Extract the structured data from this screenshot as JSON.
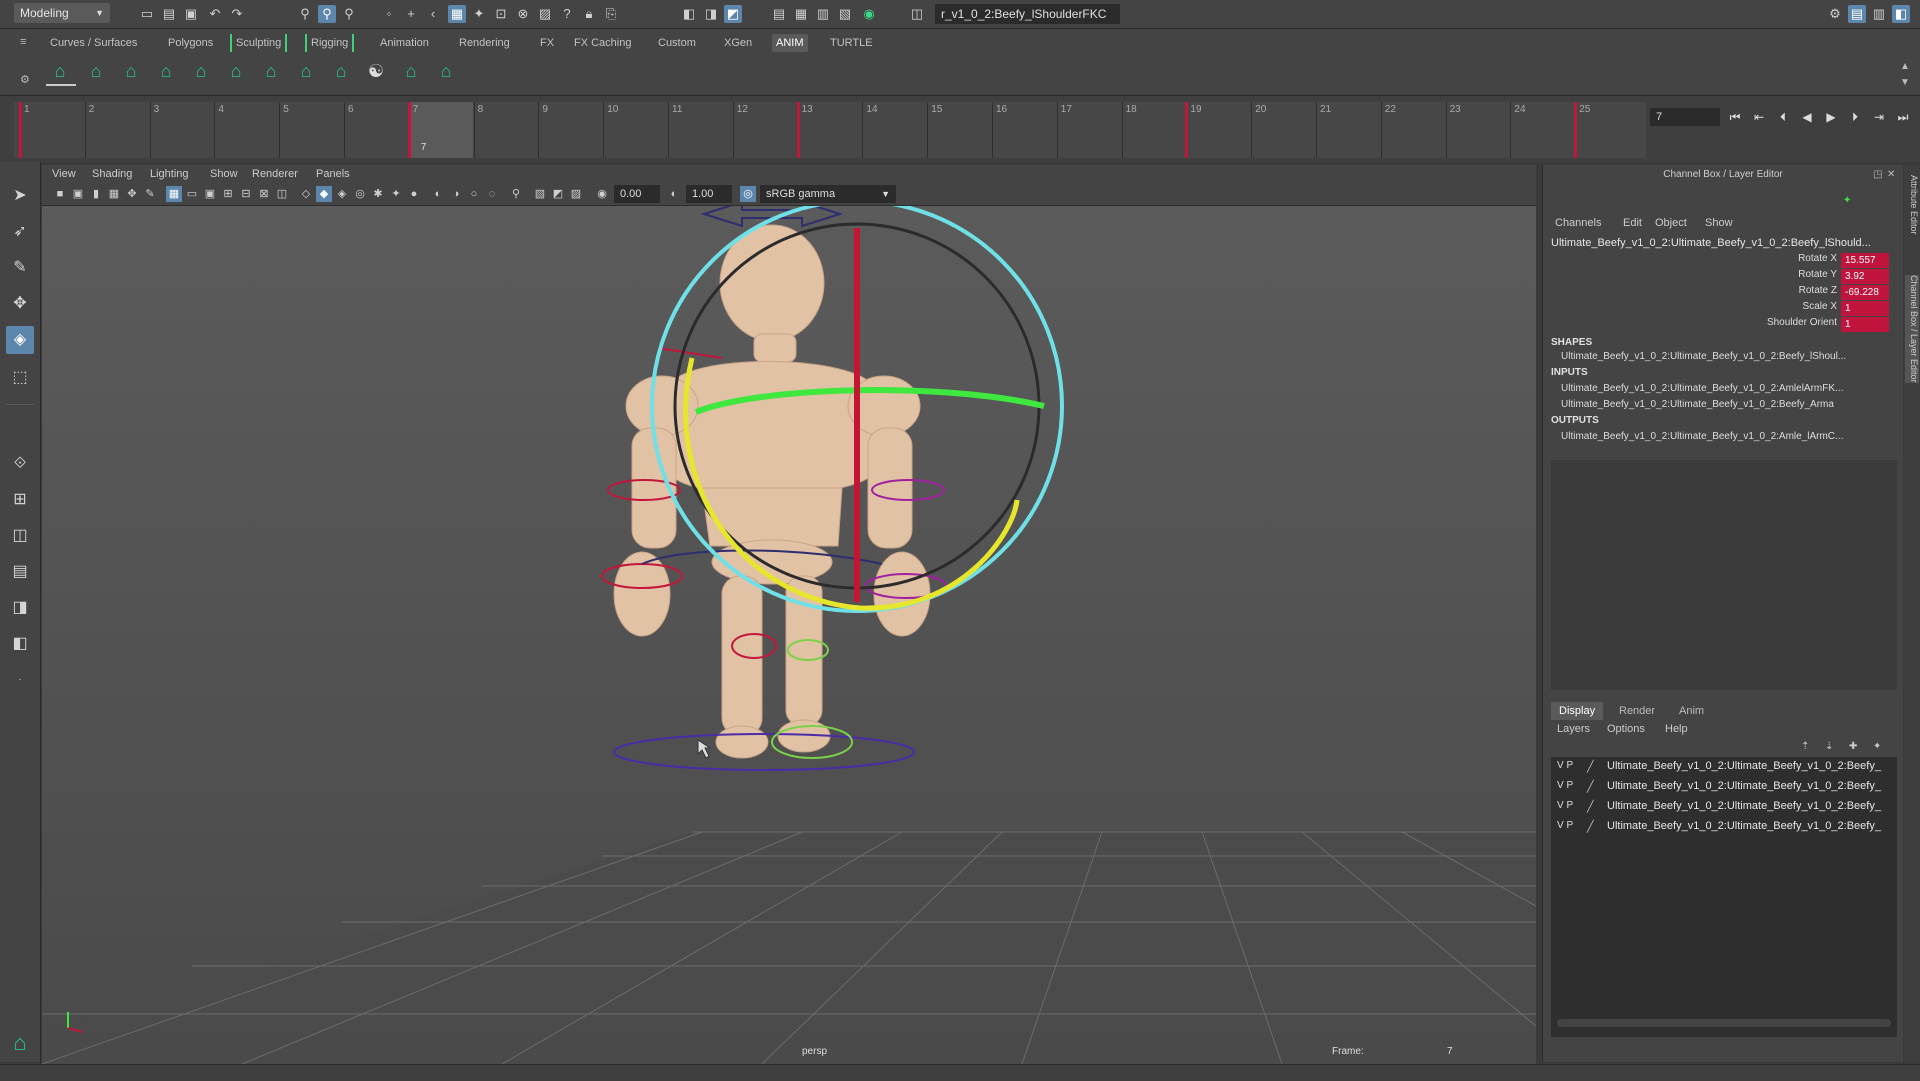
{
  "statusline": {
    "mode": "Modeling",
    "object_name": "r_v1_0_2:Beefy_lShoulderFKC"
  },
  "shelf_tabs": [
    {
      "label": "Curves / Surfaces"
    },
    {
      "label": "Polygons"
    },
    {
      "label": "Sculpting"
    },
    {
      "label": "Rigging"
    },
    {
      "label": "Animation"
    },
    {
      "label": "Rendering"
    },
    {
      "label": "FX"
    },
    {
      "label": "FX Caching"
    },
    {
      "label": "Custom"
    },
    {
      "label": "XGen"
    },
    {
      "label": "ANIM"
    },
    {
      "label": "TURTLE"
    }
  ],
  "time_slider": {
    "frame_numbers": [
      "1",
      "2",
      "3",
      "4",
      "5",
      "6",
      "7",
      "8",
      "9",
      "10",
      "11",
      "12",
      "13",
      "14",
      "15",
      "16",
      "17",
      "18",
      "19",
      "20",
      "21",
      "22",
      "23",
      "24",
      "25"
    ],
    "current_frame": "7",
    "keyframes": [
      1,
      7,
      13,
      19,
      25
    ],
    "frame_field": "7"
  },
  "viewport": {
    "menus": [
      "View",
      "Shading",
      "Lighting",
      "Show",
      "Renderer",
      "Panels"
    ],
    "exposure": "0.00",
    "gamma": "1.00",
    "color_space": "sRGB gamma",
    "camera_label": "persp",
    "frame_label": "Frame:",
    "frame_value": "7"
  },
  "channel_box": {
    "title": "Channel Box / Layer Editor",
    "menus": [
      "Channels",
      "Edit",
      "Object",
      "Show"
    ],
    "object": "Ultimate_Beefy_v1_0_2:Ultimate_Beefy_v1_0_2:Beefy_lShould...",
    "attributes": [
      {
        "label": "Rotate X",
        "value": "15.557"
      },
      {
        "label": "Rotate Y",
        "value": "3.92"
      },
      {
        "label": "Rotate Z",
        "value": "-69.228"
      },
      {
        "label": "Scale X",
        "value": "1"
      },
      {
        "label": "Shoulder Orient",
        "value": "1"
      }
    ],
    "shapes_heading": "SHAPES",
    "shapes": [
      "Ultimate_Beefy_v1_0_2:Ultimate_Beefy_v1_0_2:Beefy_lShoul..."
    ],
    "inputs_heading": "INPUTS",
    "inputs": [
      "Ultimate_Beefy_v1_0_2:Ultimate_Beefy_v1_0_2:AmlelArmFK...",
      "Ultimate_Beefy_v1_0_2:Ultimate_Beefy_v1_0_2:Beefy_Arma"
    ],
    "outputs_heading": "OUTPUTS",
    "outputs": [
      "Ultimate_Beefy_v1_0_2:Ultimate_Beefy_v1_0_2:Amle_lArmC..."
    ]
  },
  "layer_editor": {
    "tabs": [
      "Display",
      "Render",
      "Anim"
    ],
    "menus": [
      "Layers",
      "Options",
      "Help"
    ],
    "layers": [
      {
        "v": "V",
        "p": "P",
        "name": "Ultimate_Beefy_v1_0_2:Ultimate_Beefy_v1_0_2:Beefy_"
      },
      {
        "v": "V",
        "p": "P",
        "name": "Ultimate_Beefy_v1_0_2:Ultimate_Beefy_v1_0_2:Beefy_"
      },
      {
        "v": "V",
        "p": "P",
        "name": "Ultimate_Beefy_v1_0_2:Ultimate_Beefy_v1_0_2:Beefy_"
      },
      {
        "v": "V",
        "p": "P",
        "name": "Ultimate_Beefy_v1_0_2:Ultimate_Beefy_v1_0_2:Beefy_"
      }
    ]
  },
  "side_tabs": [
    "Attribute Editor",
    "Channel Box / Layer Editor"
  ],
  "colors": {
    "key_red": "#c2163a",
    "attr_red": "#c0143c",
    "select_blue": "#5d86ad",
    "shelf_green": "#27c28a"
  }
}
